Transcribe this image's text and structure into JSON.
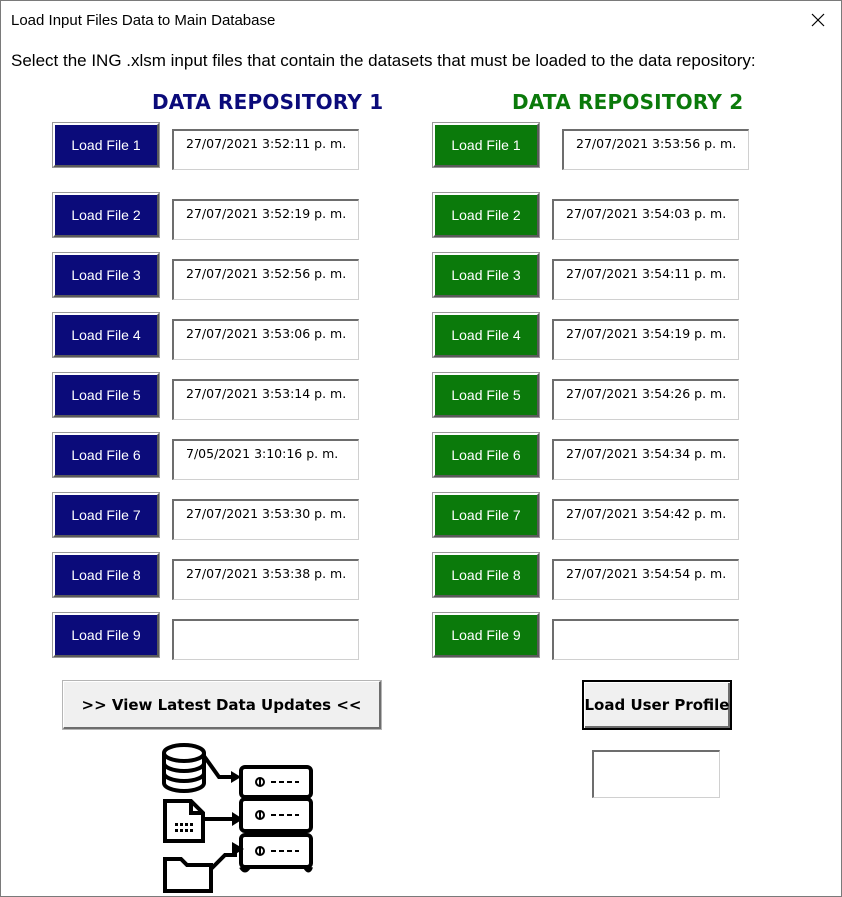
{
  "window": {
    "title": "Load Input Files Data to Main Database",
    "close_label": "✕"
  },
  "instruction": "Select the ING .xlsm input files that contain the datasets that must be loaded to the data repository:",
  "repo1": {
    "heading": "DATA REPOSITORY 1",
    "color": "#0b0b7a",
    "files": [
      {
        "label": "Load File 1",
        "timestamp": "27/07/2021 3:52:11 p. m."
      },
      {
        "label": "Load File 2",
        "timestamp": "27/07/2021 3:52:19 p. m."
      },
      {
        "label": "Load File 3",
        "timestamp": "27/07/2021 3:52:56 p. m."
      },
      {
        "label": "Load File 4",
        "timestamp": "27/07/2021 3:53:06 p. m."
      },
      {
        "label": "Load File 5",
        "timestamp": "27/07/2021 3:53:14 p. m."
      },
      {
        "label": "Load File 6",
        "timestamp": "7/05/2021 3:10:16 p. m."
      },
      {
        "label": "Load File 7",
        "timestamp": "27/07/2021 3:53:30 p. m."
      },
      {
        "label": "Load File 8",
        "timestamp": "27/07/2021 3:53:38 p. m."
      },
      {
        "label": "Load File 9",
        "timestamp": ""
      }
    ]
  },
  "repo2": {
    "heading": "DATA REPOSITORY 2",
    "color": "#0b7a0b",
    "files": [
      {
        "label": "Load File 1",
        "timestamp": "27/07/2021 3:53:56 p. m."
      },
      {
        "label": "Load File 2",
        "timestamp": "27/07/2021 3:54:03 p. m."
      },
      {
        "label": "Load File 3",
        "timestamp": "27/07/2021 3:54:11 p. m."
      },
      {
        "label": "Load File 4",
        "timestamp": "27/07/2021 3:54:19 p. m."
      },
      {
        "label": "Load File 5",
        "timestamp": "27/07/2021 3:54:26 p. m."
      },
      {
        "label": "Load File 6",
        "timestamp": "27/07/2021 3:54:34 p. m."
      },
      {
        "label": "Load File 7",
        "timestamp": "27/07/2021 3:54:42 p. m."
      },
      {
        "label": "Load File 8",
        "timestamp": "27/07/2021 3:54:54 p. m."
      },
      {
        "label": "Load File 9",
        "timestamp": ""
      }
    ]
  },
  "actions": {
    "view_updates_label": ">> View Latest Data Updates <<",
    "load_profile_label": "Load User Profile",
    "profile_value": ""
  },
  "graphic": {
    "icon": "database-servers-icon"
  }
}
